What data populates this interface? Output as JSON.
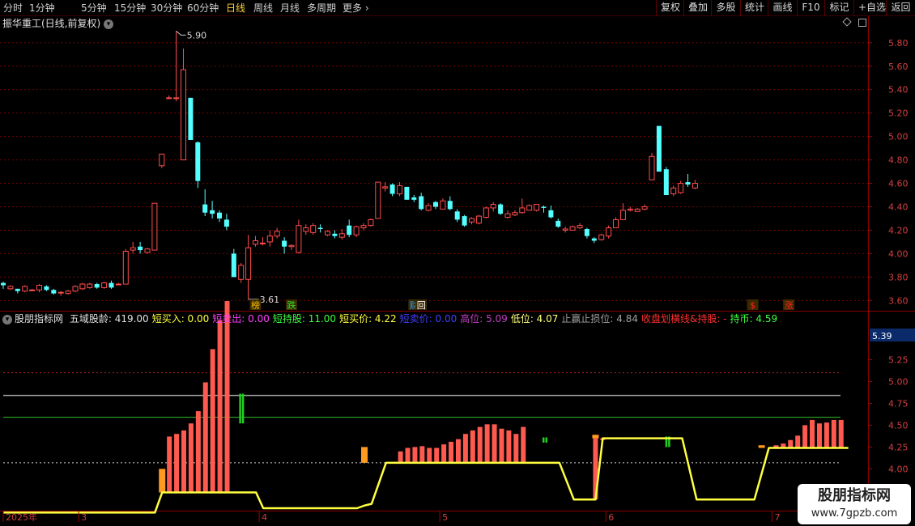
{
  "toolbar": {
    "period_tabs": [
      "分时",
      "1分钟",
      "5分钟",
      "15分钟",
      "30分钟",
      "60分钟",
      "日线",
      "周线",
      "月线",
      "多周期",
      "更多"
    ],
    "active_tab": "日线",
    "right_buttons": [
      "复权",
      "叠加",
      "多股",
      "统计",
      "画线",
      "F10",
      "标记",
      "+自选",
      "返回"
    ]
  },
  "chart_header": {
    "stock_title": "振华重工(日线,前复权)"
  },
  "price_axis": [
    "5.80",
    "5.60",
    "5.40",
    "5.20",
    "5.00",
    "4.80",
    "4.60",
    "4.40",
    "4.20",
    "4.00",
    "3.80",
    "3.60"
  ],
  "price_annotations": {
    "high": "5.90",
    "low": "3.61"
  },
  "event_markers": [
    {
      "label": "榜",
      "color": "#ffc000"
    },
    {
      "label": "跌",
      "color": "#30e030"
    },
    {
      "label": "财",
      "color": "#30a0ff"
    },
    {
      "label": "回",
      "color": "#ffffff"
    },
    {
      "label": "$",
      "color": "#ff2020"
    },
    {
      "label": "涨",
      "color": "#ff2020"
    }
  ],
  "indicator_header": {
    "name": "股朋指标网",
    "items": [
      {
        "label": "五域股龄:",
        "value": "419.00",
        "color": "#e0e0e0"
      },
      {
        "label": "短买入:",
        "value": "0.00",
        "color": "#ffff40"
      },
      {
        "label": "短卖出:",
        "value": "0.00",
        "color": "#ff40ff"
      },
      {
        "label": "短持股:",
        "value": "11.00",
        "color": "#40ff40"
      },
      {
        "label": "短买价:",
        "value": "4.22",
        "color": "#ffff40"
      },
      {
        "label": "短卖价:",
        "value": "0.00",
        "color": "#4040ff"
      },
      {
        "label": "高位:",
        "value": "5.09",
        "color": "#c040c0"
      },
      {
        "label": "低位:",
        "value": "4.07",
        "color": "#ffff80"
      },
      {
        "label": "止赢止损位:",
        "value": "4.84",
        "color": "#a0a0a0"
      },
      {
        "label": "收盘划横线&持股:",
        "value": "-",
        "color": "#ff3030"
      },
      {
        "label": "持币:",
        "value": "4.59",
        "color": "#40ff40"
      }
    ]
  },
  "indicator_axis": {
    "current": "5.39",
    "ticks": [
      "5.25",
      "5.00",
      "4.75",
      "4.50",
      "4.25",
      "4.00"
    ]
  },
  "time_axis": [
    "2025年",
    "3",
    "4",
    "5",
    "6",
    "7"
  ],
  "watermark": {
    "line1": "股朋指标网",
    "line2": "www.7gpzb.com"
  },
  "colors": {
    "up": "#ff4d4d",
    "down": "#54ffff",
    "background": "#000000",
    "grid": "#7a0000",
    "volume_bar": "#ff5a50",
    "line": "#ffff40"
  },
  "chart_data": {
    "type": "candlestick",
    "title": "振华重工(日线,前复权)",
    "ylim": [
      3.54,
      5.93
    ],
    "price_high": 5.9,
    "price_low": 3.61,
    "candles": [
      {
        "o": 3.75,
        "h": 3.76,
        "l": 3.7,
        "c": 3.73
      },
      {
        "o": 3.7,
        "h": 3.73,
        "l": 3.69,
        "c": 3.72
      },
      {
        "o": 3.7,
        "h": 3.7,
        "l": 3.66,
        "c": 3.68
      },
      {
        "o": 3.68,
        "h": 3.73,
        "l": 3.67,
        "c": 3.72
      },
      {
        "o": 3.69,
        "h": 3.7,
        "l": 3.68,
        "c": 3.69
      },
      {
        "o": 3.69,
        "h": 3.74,
        "l": 3.67,
        "c": 3.73
      },
      {
        "o": 3.72,
        "h": 3.73,
        "l": 3.68,
        "c": 3.69
      },
      {
        "o": 3.69,
        "h": 3.7,
        "l": 3.65,
        "c": 3.66
      },
      {
        "o": 3.67,
        "h": 3.68,
        "l": 3.64,
        "c": 3.67
      },
      {
        "o": 3.66,
        "h": 3.69,
        "l": 3.65,
        "c": 3.68
      },
      {
        "o": 3.68,
        "h": 3.73,
        "l": 3.67,
        "c": 3.72
      },
      {
        "o": 3.7,
        "h": 3.75,
        "l": 3.69,
        "c": 3.74
      },
      {
        "o": 3.71,
        "h": 3.75,
        "l": 3.7,
        "c": 3.74
      },
      {
        "o": 3.74,
        "h": 3.75,
        "l": 3.7,
        "c": 3.71
      },
      {
        "o": 3.71,
        "h": 3.76,
        "l": 3.7,
        "c": 3.75
      },
      {
        "o": 3.75,
        "h": 3.77,
        "l": 3.7,
        "c": 3.71
      },
      {
        "o": 3.74,
        "h": 3.75,
        "l": 3.73,
        "c": 3.74
      },
      {
        "o": 3.74,
        "h": 4.04,
        "l": 3.74,
        "c": 4.02
      },
      {
        "o": 4.03,
        "h": 4.1,
        "l": 4.0,
        "c": 4.05
      },
      {
        "o": 4.06,
        "h": 4.1,
        "l": 4.0,
        "c": 4.03
      },
      {
        "o": 4.01,
        "h": 4.05,
        "l": 4.0,
        "c": 4.04
      },
      {
        "o": 4.03,
        "h": 4.43,
        "l": 4.03,
        "c": 4.43
      },
      {
        "o": 4.75,
        "h": 4.85,
        "l": 4.73,
        "c": 4.85
      },
      {
        "o": 5.33,
        "h": 5.35,
        "l": 5.32,
        "c": 5.33
      },
      {
        "o": 5.33,
        "h": 5.9,
        "l": 5.3,
        "c": 5.33
      },
      {
        "o": 4.8,
        "h": 5.75,
        "l": 4.8,
        "c": 5.57
      },
      {
        "o": 5.33,
        "h": 5.33,
        "l": 4.97,
        "c": 4.97
      },
      {
        "o": 4.95,
        "h": 4.96,
        "l": 4.56,
        "c": 4.62
      },
      {
        "o": 4.42,
        "h": 4.55,
        "l": 4.32,
        "c": 4.35
      },
      {
        "o": 4.37,
        "h": 4.45,
        "l": 4.3,
        "c": 4.34
      },
      {
        "o": 4.35,
        "h": 4.37,
        "l": 4.27,
        "c": 4.3
      },
      {
        "o": 4.29,
        "h": 4.34,
        "l": 4.2,
        "c": 4.23
      },
      {
        "o": 4.0,
        "h": 4.04,
        "l": 3.8,
        "c": 3.8
      },
      {
        "o": 3.78,
        "h": 3.92,
        "l": 3.75,
        "c": 3.9
      },
      {
        "o": 3.78,
        "h": 4.16,
        "l": 3.61,
        "c": 4.05
      },
      {
        "o": 4.08,
        "h": 4.15,
        "l": 4.06,
        "c": 4.11
      },
      {
        "o": 4.09,
        "h": 4.14,
        "l": 4.07,
        "c": 4.09
      },
      {
        "o": 4.1,
        "h": 4.2,
        "l": 4.06,
        "c": 4.15
      },
      {
        "o": 4.15,
        "h": 4.22,
        "l": 4.13,
        "c": 4.19
      },
      {
        "o": 4.11,
        "h": 4.14,
        "l": 4.0,
        "c": 4.06
      },
      {
        "o": 4.06,
        "h": 4.08,
        "l": 4.03,
        "c": 4.07
      },
      {
        "o": 4.01,
        "h": 4.29,
        "l": 4.0,
        "c": 4.24
      },
      {
        "o": 4.19,
        "h": 4.25,
        "l": 4.16,
        "c": 4.22
      },
      {
        "o": 4.18,
        "h": 4.26,
        "l": 4.16,
        "c": 4.24
      },
      {
        "o": 4.22,
        "h": 4.25,
        "l": 4.18,
        "c": 4.21
      },
      {
        "o": 4.16,
        "h": 4.2,
        "l": 4.15,
        "c": 4.19
      },
      {
        "o": 4.17,
        "h": 4.2,
        "l": 4.13,
        "c": 4.15
      },
      {
        "o": 4.14,
        "h": 4.21,
        "l": 4.12,
        "c": 4.17
      },
      {
        "o": 4.24,
        "h": 4.29,
        "l": 4.14,
        "c": 4.16
      },
      {
        "o": 4.16,
        "h": 4.24,
        "l": 4.14,
        "c": 4.23
      },
      {
        "o": 4.22,
        "h": 4.26,
        "l": 4.2,
        "c": 4.24
      },
      {
        "o": 4.24,
        "h": 4.3,
        "l": 4.23,
        "c": 4.29
      },
      {
        "o": 4.3,
        "h": 4.61,
        "l": 4.3,
        "c": 4.61
      },
      {
        "o": 4.56,
        "h": 4.61,
        "l": 4.53,
        "c": 4.57
      },
      {
        "o": 4.59,
        "h": 4.6,
        "l": 4.49,
        "c": 4.51
      },
      {
        "o": 4.51,
        "h": 4.61,
        "l": 4.49,
        "c": 4.58
      },
      {
        "o": 4.57,
        "h": 4.57,
        "l": 4.46,
        "c": 4.46
      },
      {
        "o": 4.48,
        "h": 4.5,
        "l": 4.44,
        "c": 4.46
      },
      {
        "o": 4.49,
        "h": 4.52,
        "l": 4.37,
        "c": 4.38
      },
      {
        "o": 4.37,
        "h": 4.43,
        "l": 4.36,
        "c": 4.41
      },
      {
        "o": 4.44,
        "h": 4.45,
        "l": 4.38,
        "c": 4.4
      },
      {
        "o": 4.38,
        "h": 4.47,
        "l": 4.38,
        "c": 4.45
      },
      {
        "o": 4.45,
        "h": 4.49,
        "l": 4.37,
        "c": 4.38
      },
      {
        "o": 4.36,
        "h": 4.38,
        "l": 4.27,
        "c": 4.29
      },
      {
        "o": 4.32,
        "h": 4.33,
        "l": 4.23,
        "c": 4.24
      },
      {
        "o": 4.27,
        "h": 4.31,
        "l": 4.25,
        "c": 4.3
      },
      {
        "o": 4.26,
        "h": 4.33,
        "l": 4.25,
        "c": 4.32
      },
      {
        "o": 4.31,
        "h": 4.4,
        "l": 4.3,
        "c": 4.39
      },
      {
        "o": 4.39,
        "h": 4.44,
        "l": 4.36,
        "c": 4.42
      },
      {
        "o": 4.42,
        "h": 4.43,
        "l": 4.33,
        "c": 4.34
      },
      {
        "o": 4.31,
        "h": 4.37,
        "l": 4.3,
        "c": 4.34
      },
      {
        "o": 4.33,
        "h": 4.37,
        "l": 4.32,
        "c": 4.35
      },
      {
        "o": 4.35,
        "h": 4.47,
        "l": 4.34,
        "c": 4.39
      },
      {
        "o": 4.37,
        "h": 4.42,
        "l": 4.37,
        "c": 4.41
      },
      {
        "o": 4.37,
        "h": 4.42,
        "l": 4.36,
        "c": 4.42
      },
      {
        "o": 4.4,
        "h": 4.41,
        "l": 4.35,
        "c": 4.39
      },
      {
        "o": 4.37,
        "h": 4.41,
        "l": 4.3,
        "c": 4.31
      },
      {
        "o": 4.28,
        "h": 4.3,
        "l": 4.22,
        "c": 4.23
      },
      {
        "o": 4.2,
        "h": 4.23,
        "l": 4.18,
        "c": 4.21
      },
      {
        "o": 4.2,
        "h": 4.24,
        "l": 4.2,
        "c": 4.23
      },
      {
        "o": 4.22,
        "h": 4.26,
        "l": 4.21,
        "c": 4.24
      },
      {
        "o": 4.21,
        "h": 4.22,
        "l": 4.13,
        "c": 4.15
      },
      {
        "o": 4.13,
        "h": 4.14,
        "l": 4.09,
        "c": 4.11
      },
      {
        "o": 4.12,
        "h": 4.17,
        "l": 4.11,
        "c": 4.16
      },
      {
        "o": 4.15,
        "h": 4.24,
        "l": 4.13,
        "c": 4.22
      },
      {
        "o": 4.22,
        "h": 4.31,
        "l": 4.22,
        "c": 4.29
      },
      {
        "o": 4.29,
        "h": 4.43,
        "l": 4.29,
        "c": 4.37
      },
      {
        "o": 4.37,
        "h": 4.4,
        "l": 4.36,
        "c": 4.38
      },
      {
        "o": 4.36,
        "h": 4.39,
        "l": 4.36,
        "c": 4.38
      },
      {
        "o": 4.38,
        "h": 4.42,
        "l": 4.37,
        "c": 4.4
      },
      {
        "o": 4.63,
        "h": 4.86,
        "l": 4.63,
        "c": 4.83
      },
      {
        "o": 5.09,
        "h": 5.09,
        "l": 4.7,
        "c": 4.7
      },
      {
        "o": 4.72,
        "h": 4.74,
        "l": 4.5,
        "c": 4.5
      },
      {
        "o": 4.51,
        "h": 4.58,
        "l": 4.49,
        "c": 4.56
      },
      {
        "o": 4.52,
        "h": 4.62,
        "l": 4.51,
        "c": 4.6
      },
      {
        "o": 4.61,
        "h": 4.68,
        "l": 4.57,
        "c": 4.59
      },
      {
        "o": 4.56,
        "h": 4.63,
        "l": 4.55,
        "c": 4.6
      }
    ]
  },
  "indicator_data": {
    "ylim": [
      3.55,
      5.55
    ],
    "gray_line": 4.84,
    "green_line": 4.59,
    "red_dotted": 5.1,
    "white_dotted": 4.07,
    "bars": [
      {
        "i": 23,
        "v": 4.37
      },
      {
        "i": 24,
        "v": 4.4
      },
      {
        "i": 25,
        "v": 4.44
      },
      {
        "i": 26,
        "v": 4.52
      },
      {
        "i": 27,
        "v": 4.66
      },
      {
        "i": 28,
        "v": 4.99
      },
      {
        "i": 29,
        "v": 5.37
      },
      {
        "i": 30,
        "v": 5.7
      },
      {
        "i": 31,
        "v": 5.92
      },
      {
        "i": 55,
        "v": 4.2
      },
      {
        "i": 56,
        "v": 4.24
      },
      {
        "i": 57,
        "v": 4.25
      },
      {
        "i": 58,
        "v": 4.26
      },
      {
        "i": 59,
        "v": 4.24
      },
      {
        "i": 60,
        "v": 4.24
      },
      {
        "i": 61,
        "v": 4.28
      },
      {
        "i": 62,
        "v": 4.31
      },
      {
        "i": 63,
        "v": 4.34
      },
      {
        "i": 64,
        "v": 4.4
      },
      {
        "i": 65,
        "v": 4.44
      },
      {
        "i": 66,
        "v": 4.48
      },
      {
        "i": 67,
        "v": 4.51
      },
      {
        "i": 68,
        "v": 4.51
      },
      {
        "i": 69,
        "v": 4.46
      },
      {
        "i": 70,
        "v": 4.44
      },
      {
        "i": 71,
        "v": 4.4
      },
      {
        "i": 72,
        "v": 4.48
      },
      {
        "i": 82,
        "v": 4.35
      },
      {
        "i": 83,
        "v": 4.33
      },
      {
        "i": 84,
        "v": 4.35
      },
      {
        "i": 85,
        "v": 4.34
      },
      {
        "i": 107,
        "v": 4.27
      },
      {
        "i": 108,
        "v": 4.29
      },
      {
        "i": 109,
        "v": 4.33
      },
      {
        "i": 110,
        "v": 4.38
      },
      {
        "i": 111,
        "v": 4.5
      },
      {
        "i": 112,
        "v": 4.56
      },
      {
        "i": 113,
        "v": 4.52
      },
      {
        "i": 114,
        "v": 4.53
      },
      {
        "i": 115,
        "v": 4.56
      },
      {
        "i": 116,
        "v": 4.56
      }
    ],
    "line": [
      [
        0,
        3.5
      ],
      [
        21,
        3.5
      ],
      [
        22,
        3.73
      ],
      [
        23,
        3.73
      ],
      [
        35,
        3.73
      ],
      [
        36,
        3.55
      ],
      [
        49,
        3.55
      ],
      [
        50,
        3.58
      ],
      [
        51,
        3.6
      ],
      [
        53,
        4.07
      ],
      [
        77,
        4.07
      ],
      [
        79,
        3.65
      ],
      [
        82,
        3.65
      ],
      [
        83,
        4.35
      ],
      [
        94,
        4.35
      ],
      [
        96,
        3.65
      ],
      [
        104,
        3.65
      ],
      [
        106,
        4.24
      ],
      [
        117,
        4.24
      ]
    ]
  }
}
